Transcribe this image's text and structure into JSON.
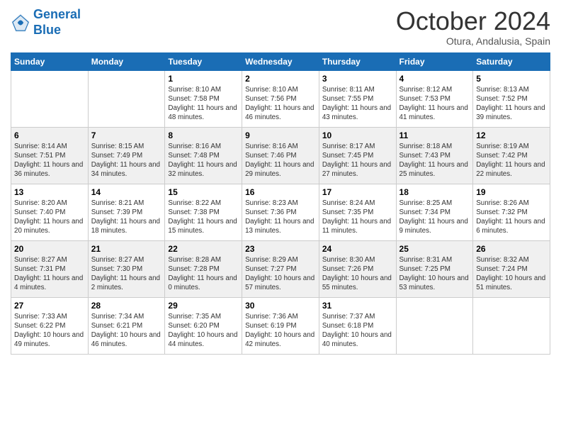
{
  "logo": {
    "line1": "General",
    "line2": "Blue"
  },
  "header": {
    "month": "October 2024",
    "location": "Otura, Andalusia, Spain"
  },
  "days_of_week": [
    "Sunday",
    "Monday",
    "Tuesday",
    "Wednesday",
    "Thursday",
    "Friday",
    "Saturday"
  ],
  "weeks": [
    [
      {
        "day": "",
        "info": ""
      },
      {
        "day": "",
        "info": ""
      },
      {
        "day": "1",
        "info": "Sunrise: 8:10 AM\nSunset: 7:58 PM\nDaylight: 11 hours and 48 minutes."
      },
      {
        "day": "2",
        "info": "Sunrise: 8:10 AM\nSunset: 7:56 PM\nDaylight: 11 hours and 46 minutes."
      },
      {
        "day": "3",
        "info": "Sunrise: 8:11 AM\nSunset: 7:55 PM\nDaylight: 11 hours and 43 minutes."
      },
      {
        "day": "4",
        "info": "Sunrise: 8:12 AM\nSunset: 7:53 PM\nDaylight: 11 hours and 41 minutes."
      },
      {
        "day": "5",
        "info": "Sunrise: 8:13 AM\nSunset: 7:52 PM\nDaylight: 11 hours and 39 minutes."
      }
    ],
    [
      {
        "day": "6",
        "info": "Sunrise: 8:14 AM\nSunset: 7:51 PM\nDaylight: 11 hours and 36 minutes."
      },
      {
        "day": "7",
        "info": "Sunrise: 8:15 AM\nSunset: 7:49 PM\nDaylight: 11 hours and 34 minutes."
      },
      {
        "day": "8",
        "info": "Sunrise: 8:16 AM\nSunset: 7:48 PM\nDaylight: 11 hours and 32 minutes."
      },
      {
        "day": "9",
        "info": "Sunrise: 8:16 AM\nSunset: 7:46 PM\nDaylight: 11 hours and 29 minutes."
      },
      {
        "day": "10",
        "info": "Sunrise: 8:17 AM\nSunset: 7:45 PM\nDaylight: 11 hours and 27 minutes."
      },
      {
        "day": "11",
        "info": "Sunrise: 8:18 AM\nSunset: 7:43 PM\nDaylight: 11 hours and 25 minutes."
      },
      {
        "day": "12",
        "info": "Sunrise: 8:19 AM\nSunset: 7:42 PM\nDaylight: 11 hours and 22 minutes."
      }
    ],
    [
      {
        "day": "13",
        "info": "Sunrise: 8:20 AM\nSunset: 7:40 PM\nDaylight: 11 hours and 20 minutes."
      },
      {
        "day": "14",
        "info": "Sunrise: 8:21 AM\nSunset: 7:39 PM\nDaylight: 11 hours and 18 minutes."
      },
      {
        "day": "15",
        "info": "Sunrise: 8:22 AM\nSunset: 7:38 PM\nDaylight: 11 hours and 15 minutes."
      },
      {
        "day": "16",
        "info": "Sunrise: 8:23 AM\nSunset: 7:36 PM\nDaylight: 11 hours and 13 minutes."
      },
      {
        "day": "17",
        "info": "Sunrise: 8:24 AM\nSunset: 7:35 PM\nDaylight: 11 hours and 11 minutes."
      },
      {
        "day": "18",
        "info": "Sunrise: 8:25 AM\nSunset: 7:34 PM\nDaylight: 11 hours and 9 minutes."
      },
      {
        "day": "19",
        "info": "Sunrise: 8:26 AM\nSunset: 7:32 PM\nDaylight: 11 hours and 6 minutes."
      }
    ],
    [
      {
        "day": "20",
        "info": "Sunrise: 8:27 AM\nSunset: 7:31 PM\nDaylight: 11 hours and 4 minutes."
      },
      {
        "day": "21",
        "info": "Sunrise: 8:27 AM\nSunset: 7:30 PM\nDaylight: 11 hours and 2 minutes."
      },
      {
        "day": "22",
        "info": "Sunrise: 8:28 AM\nSunset: 7:28 PM\nDaylight: 11 hours and 0 minutes."
      },
      {
        "day": "23",
        "info": "Sunrise: 8:29 AM\nSunset: 7:27 PM\nDaylight: 10 hours and 57 minutes."
      },
      {
        "day": "24",
        "info": "Sunrise: 8:30 AM\nSunset: 7:26 PM\nDaylight: 10 hours and 55 minutes."
      },
      {
        "day": "25",
        "info": "Sunrise: 8:31 AM\nSunset: 7:25 PM\nDaylight: 10 hours and 53 minutes."
      },
      {
        "day": "26",
        "info": "Sunrise: 8:32 AM\nSunset: 7:24 PM\nDaylight: 10 hours and 51 minutes."
      }
    ],
    [
      {
        "day": "27",
        "info": "Sunrise: 7:33 AM\nSunset: 6:22 PM\nDaylight: 10 hours and 49 minutes."
      },
      {
        "day": "28",
        "info": "Sunrise: 7:34 AM\nSunset: 6:21 PM\nDaylight: 10 hours and 46 minutes."
      },
      {
        "day": "29",
        "info": "Sunrise: 7:35 AM\nSunset: 6:20 PM\nDaylight: 10 hours and 44 minutes."
      },
      {
        "day": "30",
        "info": "Sunrise: 7:36 AM\nSunset: 6:19 PM\nDaylight: 10 hours and 42 minutes."
      },
      {
        "day": "31",
        "info": "Sunrise: 7:37 AM\nSunset: 6:18 PM\nDaylight: 10 hours and 40 minutes."
      },
      {
        "day": "",
        "info": ""
      },
      {
        "day": "",
        "info": ""
      }
    ]
  ],
  "row_styles": [
    "row-white",
    "row-shaded",
    "row-white",
    "row-shaded",
    "row-white"
  ]
}
